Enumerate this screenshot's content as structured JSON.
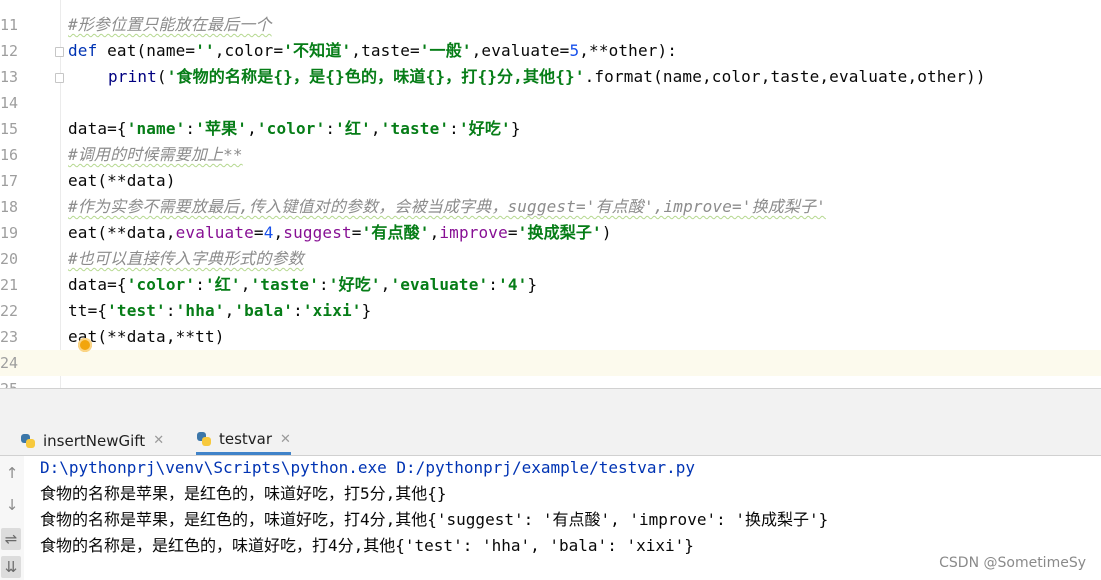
{
  "editor": {
    "lines": [
      {
        "num": "11",
        "segs": [
          {
            "t": "#形参位置只能放在最后一个",
            "c": "cmt"
          }
        ]
      },
      {
        "num": "12",
        "fold": true,
        "segs": [
          {
            "t": "def ",
            "c": "kw"
          },
          {
            "t": "eat(name=",
            "c": ""
          },
          {
            "t": "''",
            "c": "str"
          },
          {
            "t": ",color=",
            "c": ""
          },
          {
            "t": "'不知道'",
            "c": "str"
          },
          {
            "t": ",taste=",
            "c": ""
          },
          {
            "t": "'一般'",
            "c": "str"
          },
          {
            "t": ",evaluate=",
            "c": ""
          },
          {
            "t": "5",
            "c": "num"
          },
          {
            "t": ",**other):",
            "c": ""
          }
        ]
      },
      {
        "num": "13",
        "fold": true,
        "indent": true,
        "segs": [
          {
            "t": "print",
            "c": "fn"
          },
          {
            "t": "(",
            "c": ""
          },
          {
            "t": "'食物的名称是{}，是{}色的，味道{}，打{}分,其他{}'",
            "c": "str"
          },
          {
            "t": ".format(name,color,taste,evaluate,other))",
            "c": ""
          }
        ]
      },
      {
        "num": "14",
        "segs": []
      },
      {
        "num": "15",
        "segs": [
          {
            "t": "data={",
            "c": ""
          },
          {
            "t": "'name'",
            "c": "str"
          },
          {
            "t": ":",
            "c": ""
          },
          {
            "t": "'苹果'",
            "c": "str"
          },
          {
            "t": ",",
            "c": ""
          },
          {
            "t": "'color'",
            "c": "str"
          },
          {
            "t": ":",
            "c": ""
          },
          {
            "t": "'红'",
            "c": "str"
          },
          {
            "t": ",",
            "c": ""
          },
          {
            "t": "'taste'",
            "c": "str"
          },
          {
            "t": ":",
            "c": ""
          },
          {
            "t": "'好吃'",
            "c": "str"
          },
          {
            "t": "}",
            "c": ""
          }
        ]
      },
      {
        "num": "16",
        "segs": [
          {
            "t": "#调用的时候需要加上**",
            "c": "cmt"
          }
        ]
      },
      {
        "num": "17",
        "segs": [
          {
            "t": "eat(**data)",
            "c": ""
          }
        ]
      },
      {
        "num": "18",
        "segs": [
          {
            "t": "#作为实参不需要放最后,传入键值对的参数，会被当成字典，suggest='有点酸',improve='换成梨子'",
            "c": "cmt"
          }
        ]
      },
      {
        "num": "19",
        "segs": [
          {
            "t": "eat(**data,",
            "c": ""
          },
          {
            "t": "evaluate",
            "c": "prm"
          },
          {
            "t": "=",
            "c": ""
          },
          {
            "t": "4",
            "c": "num"
          },
          {
            "t": ",",
            "c": ""
          },
          {
            "t": "suggest",
            "c": "prm"
          },
          {
            "t": "=",
            "c": ""
          },
          {
            "t": "'有点酸'",
            "c": "str"
          },
          {
            "t": ",",
            "c": ""
          },
          {
            "t": "improve",
            "c": "prm"
          },
          {
            "t": "=",
            "c": ""
          },
          {
            "t": "'换成梨子'",
            "c": "str"
          },
          {
            "t": ")",
            "c": ""
          }
        ]
      },
      {
        "num": "20",
        "segs": [
          {
            "t": "#也可以直接传入字典形式的参数",
            "c": "cmt"
          }
        ]
      },
      {
        "num": "21",
        "segs": [
          {
            "t": "data={",
            "c": ""
          },
          {
            "t": "'color'",
            "c": "str"
          },
          {
            "t": ":",
            "c": ""
          },
          {
            "t": "'红'",
            "c": "str"
          },
          {
            "t": ",",
            "c": ""
          },
          {
            "t": "'taste'",
            "c": "str"
          },
          {
            "t": ":",
            "c": ""
          },
          {
            "t": "'好吃'",
            "c": "str"
          },
          {
            "t": ",",
            "c": ""
          },
          {
            "t": "'evaluate'",
            "c": "str"
          },
          {
            "t": ":",
            "c": ""
          },
          {
            "t": "'4'",
            "c": "str"
          },
          {
            "t": "}",
            "c": ""
          }
        ]
      },
      {
        "num": "22",
        "segs": [
          {
            "t": "tt={",
            "c": ""
          },
          {
            "t": "'test'",
            "c": "str"
          },
          {
            "t": ":",
            "c": ""
          },
          {
            "t": "'hha'",
            "c": "str"
          },
          {
            "t": ",",
            "c": ""
          },
          {
            "t": "'bala'",
            "c": "str"
          },
          {
            "t": ":",
            "c": ""
          },
          {
            "t": "'xixi'",
            "c": "str"
          },
          {
            "t": "}",
            "c": ""
          }
        ]
      },
      {
        "num": "23",
        "segs": [
          {
            "t": "eat(**data,**tt)",
            "c": ""
          }
        ]
      },
      {
        "num": "24",
        "current": true,
        "segs": []
      },
      {
        "num": "25",
        "segs": []
      }
    ]
  },
  "run_tabs": [
    {
      "label": "insertNewGift",
      "active": false
    },
    {
      "label": "testvar",
      "active": true
    }
  ],
  "toolbar_icons": [
    "arrow-up-icon",
    "arrow-down-icon",
    "soft-wrap-icon",
    "scroll-to-end-icon"
  ],
  "console": [
    {
      "text": "D:\\pythonprj\\venv\\Scripts\\python.exe D:/pythonprj/example/testvar.py",
      "kind": "path"
    },
    {
      "text": "食物的名称是苹果，是红色的，味道好吃，打5分,其他{}",
      "kind": "out"
    },
    {
      "text": "食物的名称是苹果，是红色的，味道好吃，打4分,其他{'suggest': '有点酸', 'improve': '换成梨子'}",
      "kind": "out"
    },
    {
      "text": "食物的名称是，是红色的，味道好吃，打4分,其他{'test': 'hha', 'bala': 'xixi'}",
      "kind": "out"
    }
  ],
  "watermark": "CSDN @SometimeSy",
  "colors": {
    "keyword": "#0033b3",
    "string": "#067d17",
    "number": "#1750eb",
    "param": "#871094",
    "comment": "#8c8c8c",
    "current_line": "#fcfaed",
    "active_tab": "#4083c9"
  }
}
